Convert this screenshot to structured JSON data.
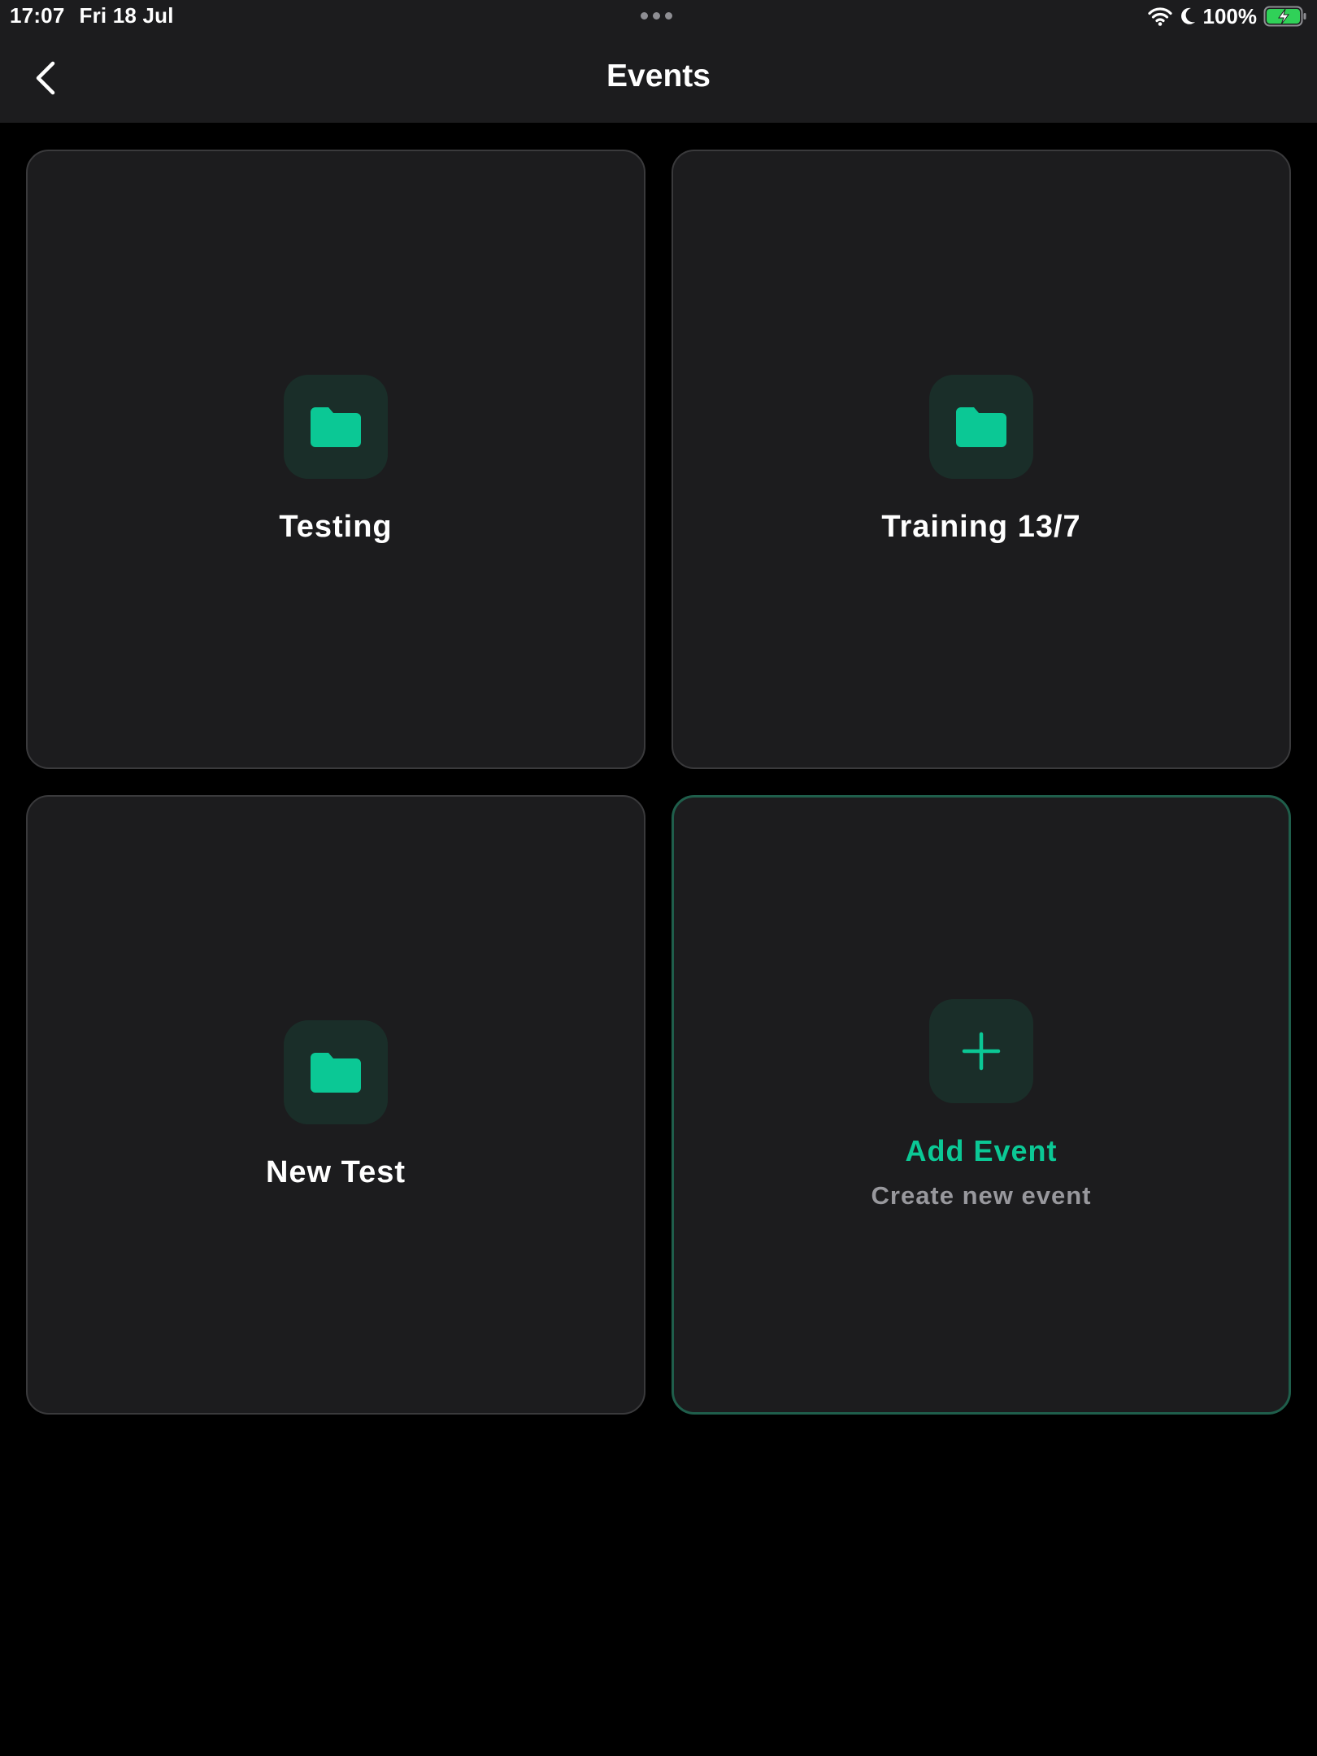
{
  "status_bar": {
    "time": "17:07",
    "date": "Fri 18 Jul",
    "battery": "100%"
  },
  "nav": {
    "title": "Events"
  },
  "events": [
    {
      "title": "Testing"
    },
    {
      "title": "Training 13/7"
    },
    {
      "title": "New Test"
    }
  ],
  "add_event": {
    "title": "Add Event",
    "subtitle": "Create new event"
  },
  "colors": {
    "accent": "#0bc895",
    "card_background": "#1c1c1e",
    "icon_tile": "#1a2e29",
    "card_border": "#3a3a3c",
    "add_card_border": "#1f5e4b",
    "battery_fill": "#30d158"
  },
  "icons": {
    "back": "chevron-left-icon",
    "event": "folder-icon",
    "add": "plus-icon",
    "wifi": "wifi-icon",
    "focus": "moon-icon",
    "battery": "battery-charging-icon"
  }
}
